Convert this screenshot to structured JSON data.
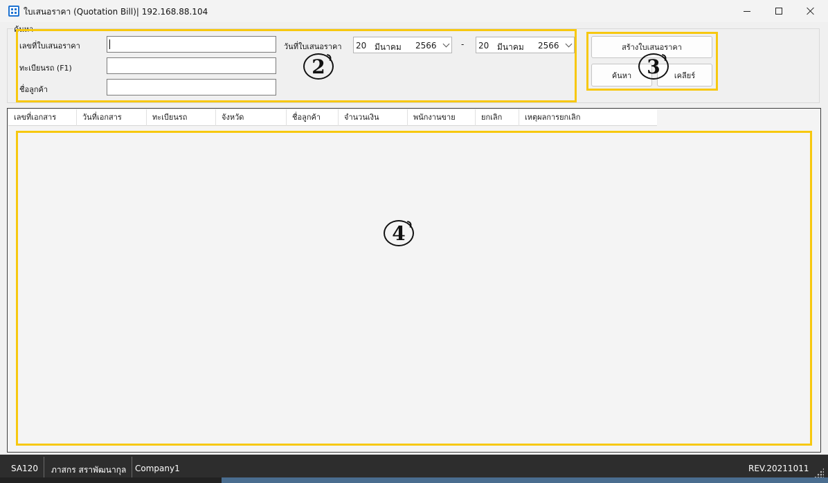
{
  "window": {
    "title": "ใบเสนอราคา (Quotation Bill)| 192.168.88.104"
  },
  "search": {
    "group_label": "ค้นหา",
    "doc_no_label": "เลขที่ใบเสนอราคา",
    "doc_no_value": "",
    "plate_label": "ทะเบียนรถ (F1)",
    "plate_value": "",
    "customer_label": "ชื่อลูกค้า",
    "customer_value": "",
    "date_label": "วันที่ใบเสนอราคา",
    "date_separator": "-",
    "date_from": {
      "day": "20",
      "month": "มีนาคม",
      "year": "2566"
    },
    "date_to": {
      "day": "20",
      "month": "มีนาคม",
      "year": "2566"
    }
  },
  "actions": {
    "create_label": "สร้างใบเสนอราคา",
    "search_label": "ค้นหา",
    "clear_label": "เคลียร์"
  },
  "grid": {
    "columns": [
      "เลขที่เอกสาร",
      "วันที่เอกสาร",
      "ทะเบียนรถ",
      "จังหวัด",
      "ชื่อลูกค้า",
      "จำนวนเงิน",
      "พนักงานขาย",
      "ยกเลิก",
      "เหตุผลการยกเลิก"
    ],
    "rows": []
  },
  "annotations": {
    "marker_2": "2",
    "marker_3": "3",
    "marker_4": "4",
    "highlight_color": "#f7c80f"
  },
  "status": {
    "code": "SA120",
    "user": "ภาสกร สราพัฒนากุล",
    "company": "Company1",
    "revision": "REV.20211011"
  },
  "icons": [
    "app-grid-icon",
    "minimize-icon",
    "maximize-icon",
    "close-icon",
    "chevron-down-icon",
    "resize-grip-icon"
  ]
}
